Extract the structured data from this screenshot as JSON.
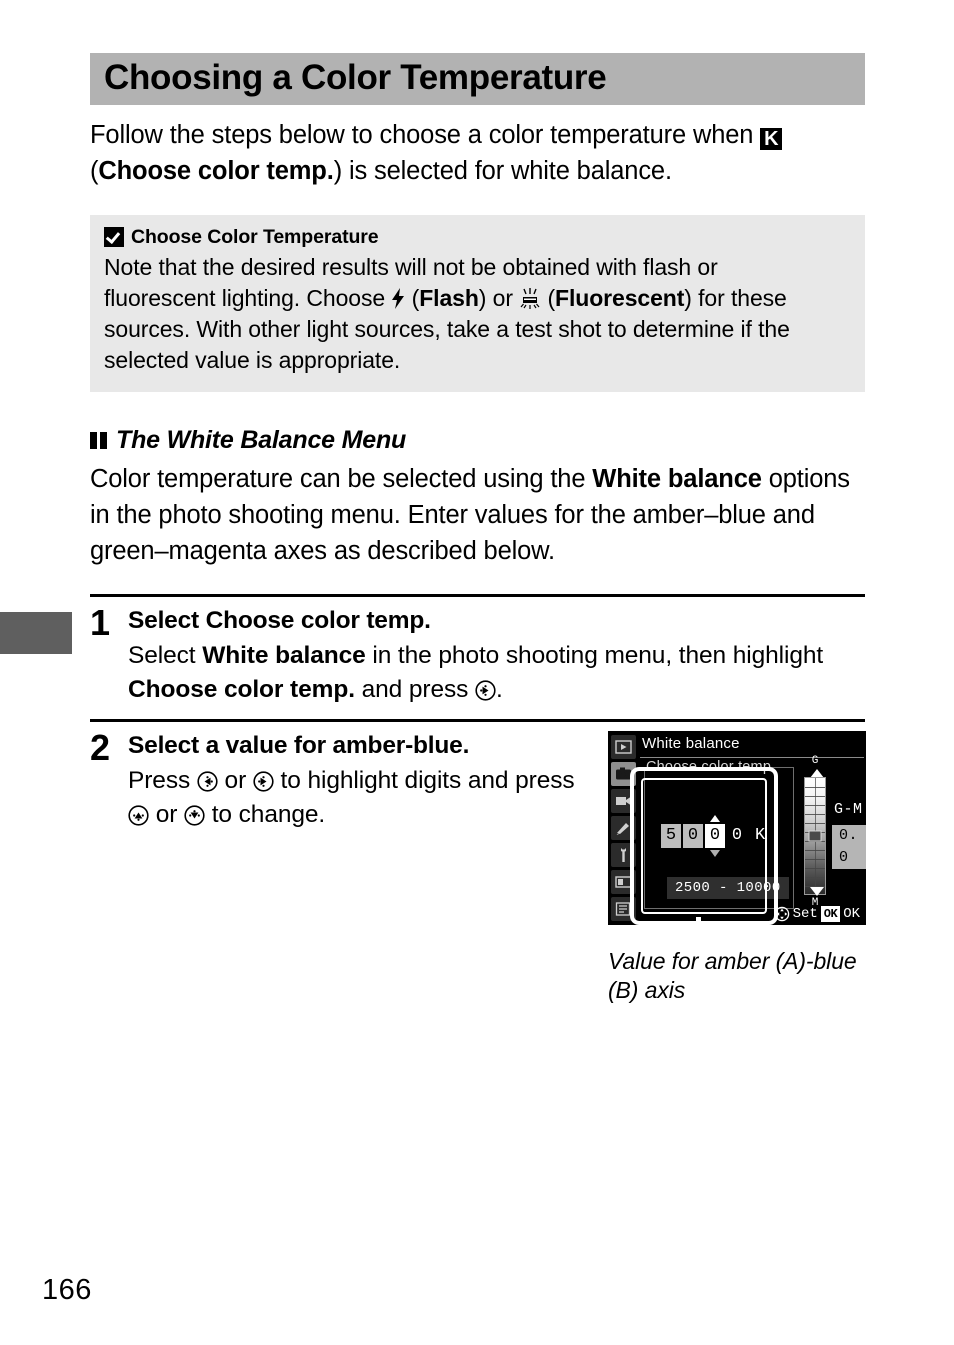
{
  "page": {
    "number": "166",
    "title": "Choosing a Color Temperature"
  },
  "intro": {
    "part1": "Follow the steps below to choose a color temperature when ",
    "k_glyph": "K",
    "part2": "(",
    "bold1": "Choose color temp.",
    "part3": ") is selected for white balance."
  },
  "note": {
    "icon": "caution-icon",
    "heading": "Choose Color Temperature",
    "line1": "Note that the desired results will not be obtained with flash or",
    "line2a": "fluorescent lighting.  Choose ",
    "flash_bold": "Flash",
    "line2b": ") or ",
    "fluorescent_bold": "Fluorescent",
    "line2c": ") for these",
    "line3": "sources.  With other light sources, take a test shot to determine if the",
    "line4": "selected value is appropriate."
  },
  "subsection": {
    "heading": "The White Balance Menu",
    "para_a": "Color temperature can be selected using the ",
    "para_bold": "White balance",
    "para_b": " options in the photo shooting menu.  Enter values for the amber–blue and green–magenta axes as described below."
  },
  "steps": [
    {
      "number": "1",
      "title_plain": "Select ",
      "title_bold": "Choose color temp.",
      "text_a": "Select ",
      "text_bold1": "White balance",
      "text_b": " in the photo shooting menu, then highlight ",
      "text_bold2": "Choose color temp.",
      "text_c": " and press ",
      "text_d": "."
    },
    {
      "number": "2",
      "title": "Select a value for amber-blue.",
      "text_a": "Press ",
      "text_b": " or ",
      "text_c": " to highlight digits and press ",
      "text_d": " or ",
      "text_e": " to change."
    }
  ],
  "figure": {
    "lcd": {
      "title": "White balance",
      "subtitle": "Choose color temp.",
      "digits": [
        {
          "value": "5",
          "state": "filled"
        },
        {
          "value": "0",
          "state": "filled"
        },
        {
          "value": "0",
          "state": "selected"
        },
        {
          "value": "0",
          "state": "plain"
        }
      ],
      "unit": "K",
      "range": "2500 - 10000",
      "gm_label_top": "G",
      "gm_label_bottom": "M",
      "gm_name": "G-M",
      "gm_value": "0. 0",
      "footer_set": "Set",
      "footer_ok_chip": "OK",
      "footer_ok": "OK",
      "rail_icons": [
        "playback-icon",
        "photo-shooting-menu-icon",
        "movie-shooting-menu-icon",
        "custom-settings-icon",
        "setup-menu-icon",
        "retouch-menu-icon",
        "recent-settings-icon"
      ]
    },
    "caption": "Value for amber (A)-blue (B) axis"
  },
  "colors": {
    "title_banner": "#b2b2b2",
    "note_background": "#e8e8e8",
    "chapter_tab": "#5f5f5f",
    "lcd_background": "#000000"
  }
}
